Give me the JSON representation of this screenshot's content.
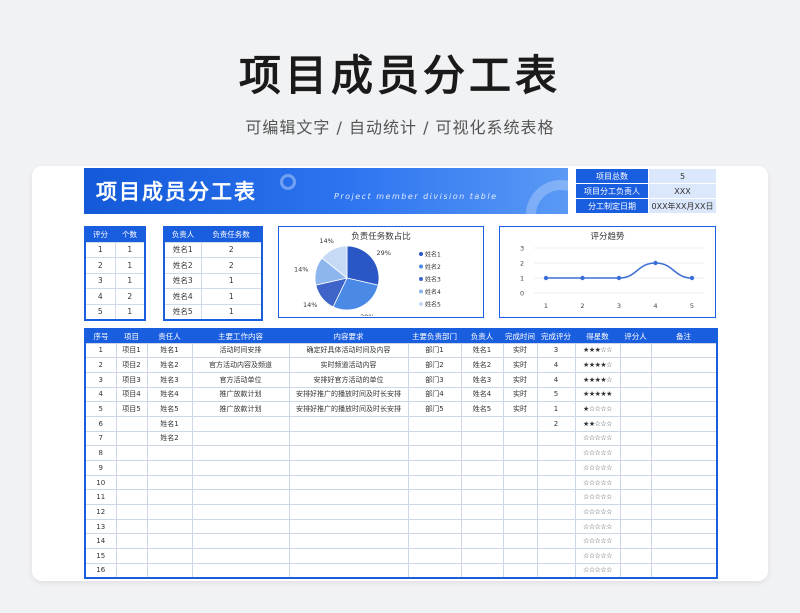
{
  "page": {
    "title": "项目成员分工表",
    "subtitle": "可编辑文字 / 自动统计 / 可视化系统表格"
  },
  "banner": {
    "title": "项目成员分工表",
    "subtitle_en": "Project member division table"
  },
  "info": [
    {
      "key": "项目总数",
      "value": "5"
    },
    {
      "key": "项目分工负责人",
      "value": "XXX"
    },
    {
      "key": "分工制定日期",
      "value": "0XX年XX月XX日"
    }
  ],
  "rating_table": {
    "headers": [
      "评分",
      "个数"
    ],
    "rows": [
      [
        "1",
        "1"
      ],
      [
        "2",
        "1"
      ],
      [
        "3",
        "1"
      ],
      [
        "4",
        "2"
      ],
      [
        "5",
        "1"
      ]
    ]
  },
  "person_table": {
    "headers": [
      "负责人",
      "负责任务数"
    ],
    "rows": [
      [
        "姓名1",
        "2"
      ],
      [
        "姓名2",
        "2"
      ],
      [
        "姓名3",
        "1"
      ],
      [
        "姓名4",
        "1"
      ],
      [
        "姓名5",
        "1"
      ]
    ]
  },
  "charts": {
    "colors": {
      "pie": [
        "#2b56c6",
        "#4a8ae6",
        "#3e64c9",
        "#8eb6ee",
        "#c6daf5"
      ],
      "line": "#3b6ed6"
    }
  },
  "chart_data": [
    {
      "type": "pie",
      "title": "负责任务数占比",
      "labels": [
        "姓名1",
        "姓名2",
        "姓名3",
        "姓名4",
        "姓名5"
      ],
      "values": [
        2,
        2,
        1,
        1,
        1
      ],
      "data_labels": [
        "29%",
        "29%",
        "14%",
        "14%",
        "14%"
      ],
      "legend_position": "right"
    },
    {
      "type": "line",
      "title": "评分趋势",
      "x": [
        "1",
        "2",
        "3",
        "4",
        "5"
      ],
      "values": [
        1,
        1,
        1,
        2,
        1
      ],
      "yticks": [
        "0",
        "1",
        "2",
        "3"
      ],
      "ylim": [
        0,
        3
      ],
      "grid": true
    }
  ],
  "main_table": {
    "headers": [
      "序号",
      "项目",
      "责任人",
      "主要工作内容",
      "内容要求",
      "主要负责部门",
      "负责人",
      "完成时间",
      "完成评分",
      "得星数",
      "评分人",
      "备注"
    ],
    "rows": [
      [
        "1",
        "项目1",
        "姓名1",
        "活动时间安排",
        "确定好具体活动时间及内容",
        "部门1",
        "姓名1",
        "实时",
        "3",
        "★★★☆☆",
        "",
        ""
      ],
      [
        "2",
        "项目2",
        "姓名2",
        "官方活动内容及频道",
        "实时频道活动内容",
        "部门2",
        "姓名2",
        "实时",
        "4",
        "★★★★☆",
        "",
        ""
      ],
      [
        "3",
        "项目3",
        "姓名3",
        "官方活动单位",
        "安排好官方活动的单位",
        "部门3",
        "姓名3",
        "实时",
        "4",
        "★★★★☆",
        "",
        ""
      ],
      [
        "4",
        "项目4",
        "姓名4",
        "推广放款计划",
        "安排好推广的播放时间及时长安排",
        "部门4",
        "姓名4",
        "实时",
        "5",
        "★★★★★",
        "",
        ""
      ],
      [
        "5",
        "项目5",
        "姓名5",
        "推广放款计划",
        "安排好推广的播放时间及时长安排",
        "部门5",
        "姓名5",
        "实时",
        "1",
        "★☆☆☆☆",
        "",
        ""
      ],
      [
        "6",
        "",
        "姓名1",
        "",
        "",
        "",
        "",
        "",
        "2",
        "★★☆☆☆",
        "",
        ""
      ],
      [
        "7",
        "",
        "姓名2",
        "",
        "",
        "",
        "",
        "",
        "",
        "☆☆☆☆☆",
        "",
        ""
      ],
      [
        "8",
        "",
        "",
        "",
        "",
        "",
        "",
        "",
        "",
        "☆☆☆☆☆",
        "",
        ""
      ],
      [
        "9",
        "",
        "",
        "",
        "",
        "",
        "",
        "",
        "",
        "☆☆☆☆☆",
        "",
        ""
      ],
      [
        "10",
        "",
        "",
        "",
        "",
        "",
        "",
        "",
        "",
        "☆☆☆☆☆",
        "",
        ""
      ],
      [
        "11",
        "",
        "",
        "",
        "",
        "",
        "",
        "",
        "",
        "☆☆☆☆☆",
        "",
        ""
      ],
      [
        "12",
        "",
        "",
        "",
        "",
        "",
        "",
        "",
        "",
        "☆☆☆☆☆",
        "",
        ""
      ],
      [
        "13",
        "",
        "",
        "",
        "",
        "",
        "",
        "",
        "",
        "☆☆☆☆☆",
        "",
        ""
      ],
      [
        "14",
        "",
        "",
        "",
        "",
        "",
        "",
        "",
        "",
        "☆☆☆☆☆",
        "",
        ""
      ],
      [
        "15",
        "",
        "",
        "",
        "",
        "",
        "",
        "",
        "",
        "☆☆☆☆☆",
        "",
        ""
      ],
      [
        "16",
        "",
        "",
        "",
        "",
        "",
        "",
        "",
        "",
        "☆☆☆☆☆",
        "",
        ""
      ]
    ]
  }
}
